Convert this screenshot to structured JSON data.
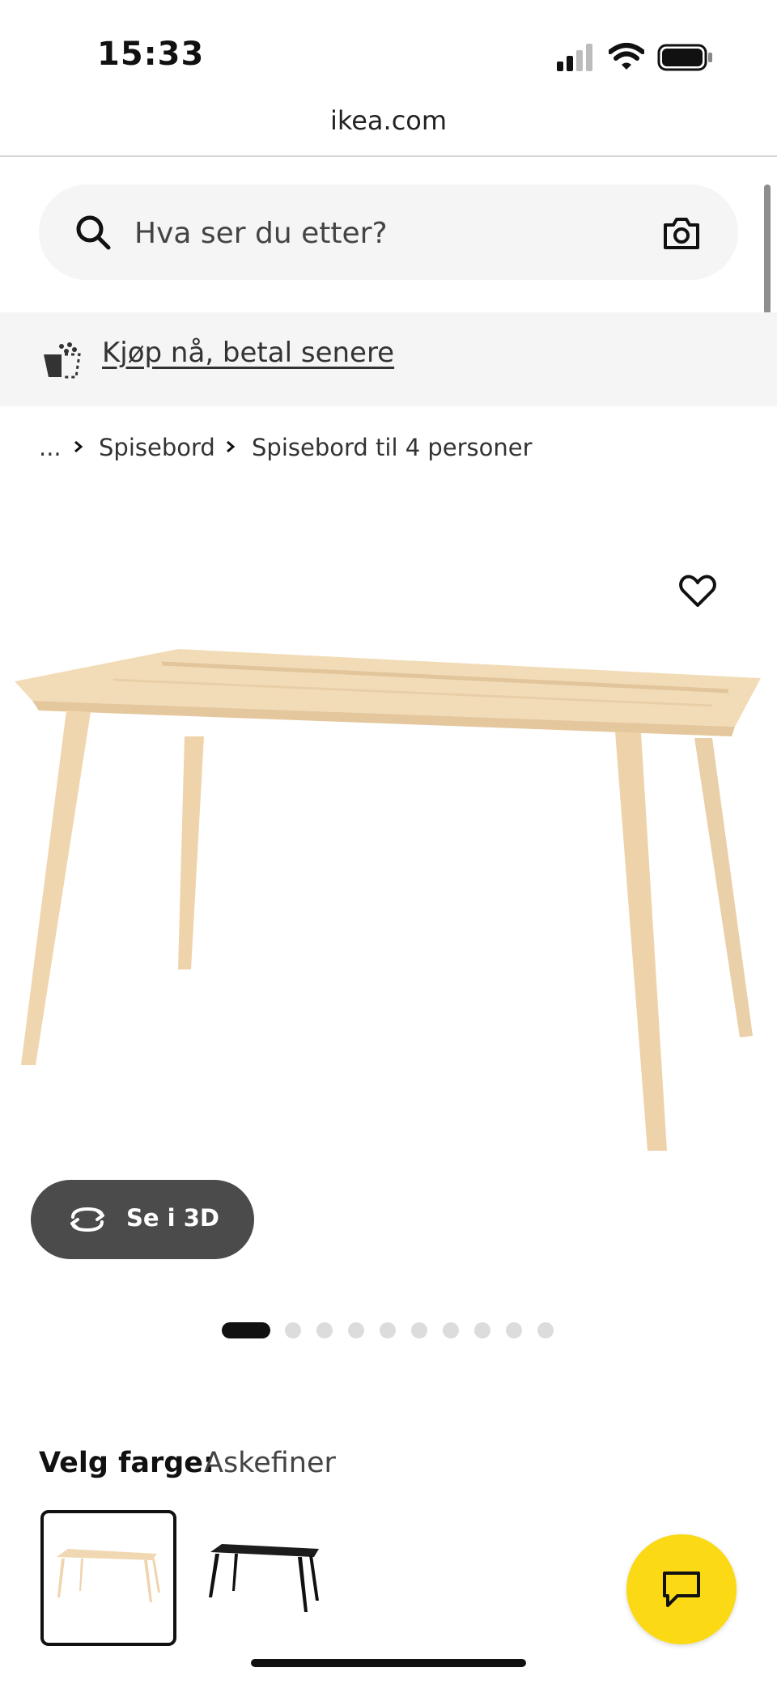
{
  "status_bar": {
    "time": "15:33"
  },
  "browser": {
    "url": "ikea.com"
  },
  "search": {
    "placeholder": "Hva ser du etter?"
  },
  "promo": {
    "link_text": "Kjøp nå, betal senere"
  },
  "breadcrumb": {
    "items": [
      "...",
      "Spisebord",
      "Spisebord til 4 personer"
    ]
  },
  "product": {
    "view_3d_label": "Se i 3D",
    "image_count": 10,
    "active_image": 1
  },
  "color_select": {
    "label": "Velg farge:",
    "selected_value": "Askefiner",
    "options": [
      "Askefiner",
      "black"
    ]
  },
  "colors": {
    "chat_button": "#fbd914",
    "wood": "#f0d7ae",
    "button_dark": "#4b4b4b"
  },
  "icons": [
    "search-icon",
    "camera-icon",
    "heart-icon",
    "rotate-icon",
    "chat-icon"
  ]
}
